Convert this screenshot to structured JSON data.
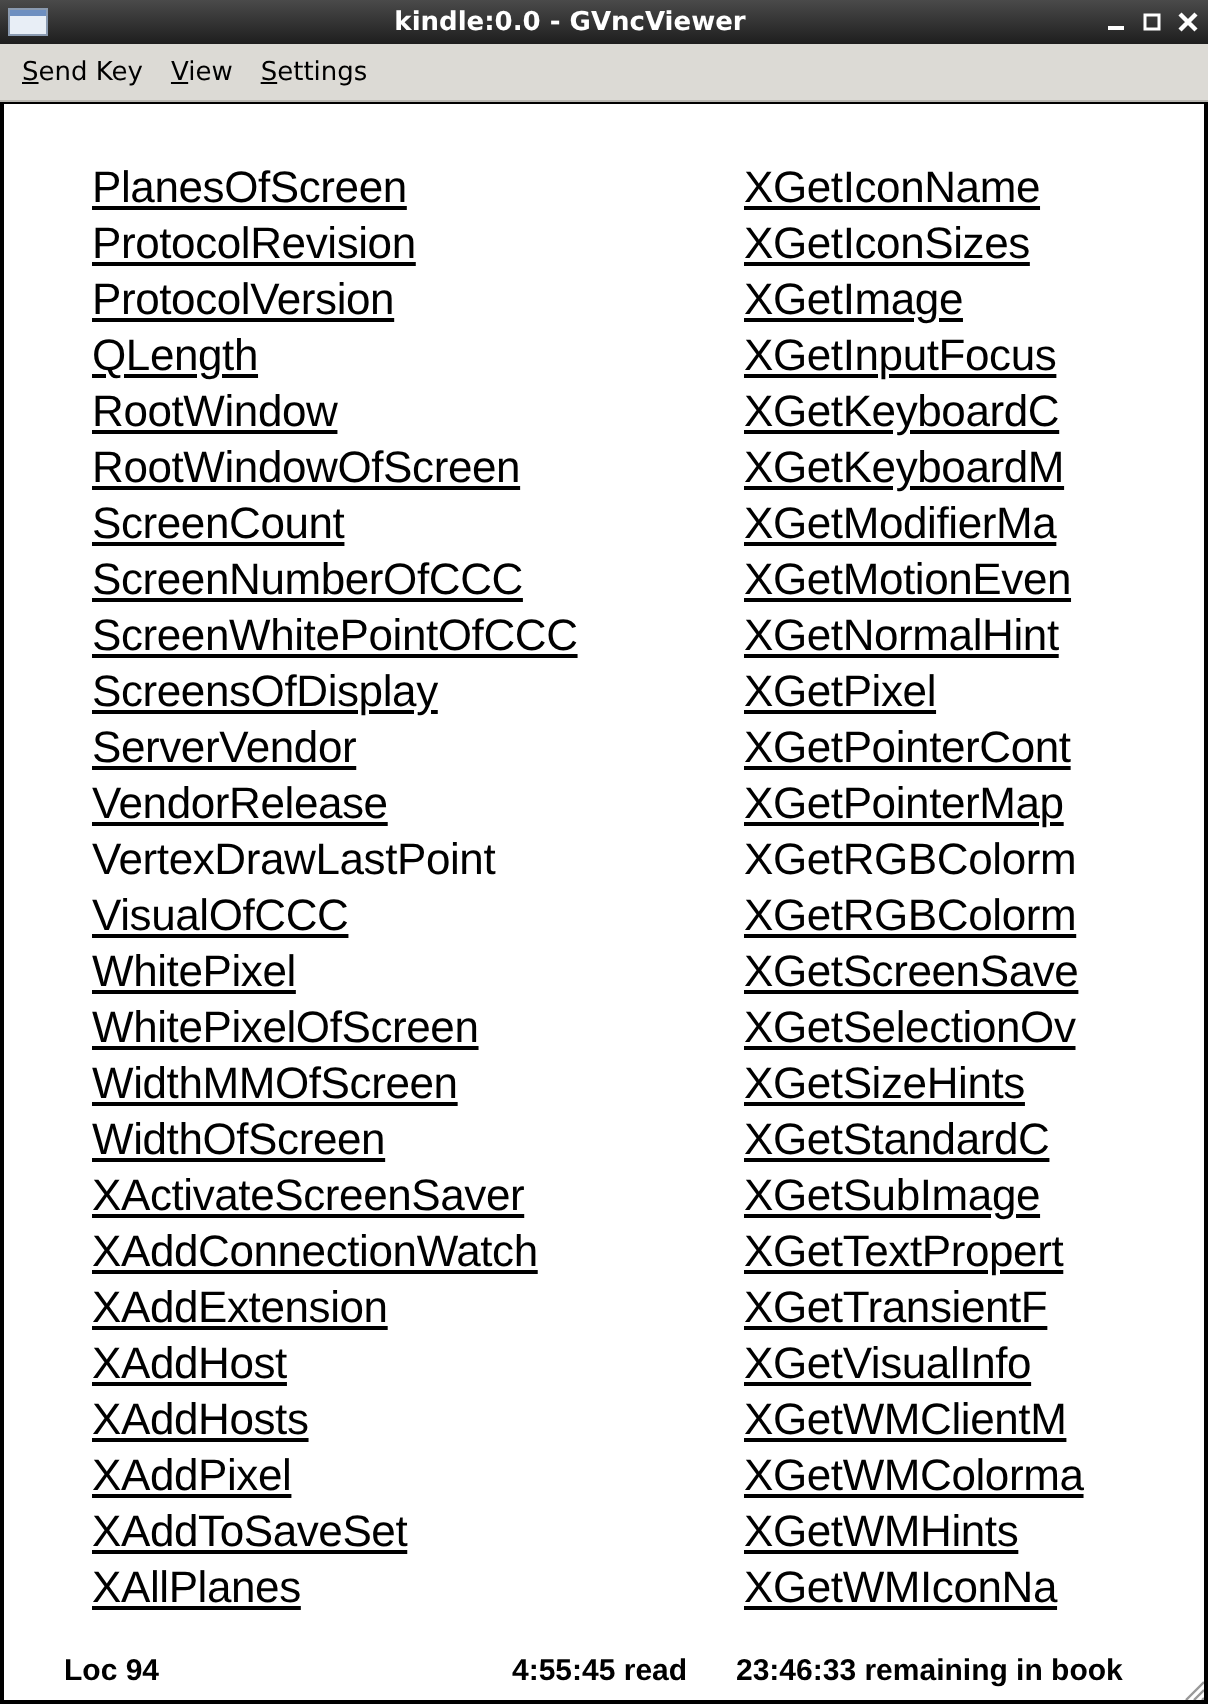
{
  "window": {
    "title": "kindle:0.0 - GVncViewer"
  },
  "menu": [
    {
      "mnemonic": "S",
      "rest": "end Key"
    },
    {
      "mnemonic": "V",
      "rest": "iew"
    },
    {
      "mnemonic": "S",
      "rest": "ettings"
    }
  ],
  "columns": [
    {
      "items": [
        {
          "text": "PlanesOfScreen",
          "link": true
        },
        {
          "text": "ProtocolRevision",
          "link": true
        },
        {
          "text": "ProtocolVersion",
          "link": true
        },
        {
          "text": "QLength",
          "link": true
        },
        {
          "text": "RootWindow",
          "link": true
        },
        {
          "text": "RootWindowOfScreen",
          "link": true
        },
        {
          "text": "ScreenCount",
          "link": true
        },
        {
          "text": "ScreenNumberOfCCC",
          "link": true
        },
        {
          "text": "ScreenWhitePointOfCCC",
          "link": true
        },
        {
          "text": "ScreensOfDisplay",
          "link": true
        },
        {
          "text": "ServerVendor",
          "link": true
        },
        {
          "text": "VendorRelease",
          "link": true
        },
        {
          "text": "VertexDrawLastPoint",
          "link": false
        },
        {
          "text": "VisualOfCCC",
          "link": true
        },
        {
          "text": "WhitePixel",
          "link": true
        },
        {
          "text": "WhitePixelOfScreen",
          "link": true
        },
        {
          "text": "WidthMMOfScreen",
          "link": true
        },
        {
          "text": "WidthOfScreen",
          "link": true
        },
        {
          "text": "XActivateScreenSaver",
          "link": true
        },
        {
          "text": "XAddConnectionWatch",
          "link": true
        },
        {
          "text": "XAddExtension",
          "link": true
        },
        {
          "text": "XAddHost",
          "link": true
        },
        {
          "text": "XAddHosts",
          "link": true
        },
        {
          "text": "XAddPixel",
          "link": true
        },
        {
          "text": "XAddToSaveSet",
          "link": true
        },
        {
          "text": "XAllPlanes",
          "link": true
        }
      ]
    },
    {
      "items": [
        {
          "text": "XGetIconName",
          "link": true
        },
        {
          "text": "XGetIconSizes",
          "link": true
        },
        {
          "text": "XGetImage",
          "link": true
        },
        {
          "text": "XGetInputFocus",
          "link": true
        },
        {
          "text": "XGetKeyboardC",
          "link": true
        },
        {
          "text": "XGetKeyboardM",
          "link": true
        },
        {
          "text": "XGetModifierMa",
          "link": true
        },
        {
          "text": "XGetMotionEven",
          "link": true
        },
        {
          "text": "XGetNormalHint",
          "link": true
        },
        {
          "text": "XGetPixel",
          "link": true
        },
        {
          "text": "XGetPointerCont",
          "link": true
        },
        {
          "text": "XGetPointerMap",
          "link": true
        },
        {
          "text": "XGetRGBColorm",
          "link": false
        },
        {
          "text": "XGetRGBColorm",
          "link": true
        },
        {
          "text": "XGetScreenSave",
          "link": true
        },
        {
          "text": "XGetSelectionOv",
          "link": true
        },
        {
          "text": "XGetSizeHints",
          "link": true
        },
        {
          "text": "XGetStandardC",
          "link": true
        },
        {
          "text": "XGetSubImage",
          "link": true
        },
        {
          "text": "XGetTextPropert",
          "link": true
        },
        {
          "text": "XGetTransientF",
          "link": true
        },
        {
          "text": "XGetVisualInfo",
          "link": true
        },
        {
          "text": "XGetWMClientM",
          "link": true
        },
        {
          "text": "XGetWMColorma",
          "link": true
        },
        {
          "text": "XGetWMHints",
          "link": true
        },
        {
          "text": "XGetWMIconNa",
          "link": true
        }
      ]
    }
  ],
  "status_bar": {
    "location": "Loc 94",
    "read": "4:55:45 read",
    "remaining": "23:46:33 remaining in book"
  }
}
